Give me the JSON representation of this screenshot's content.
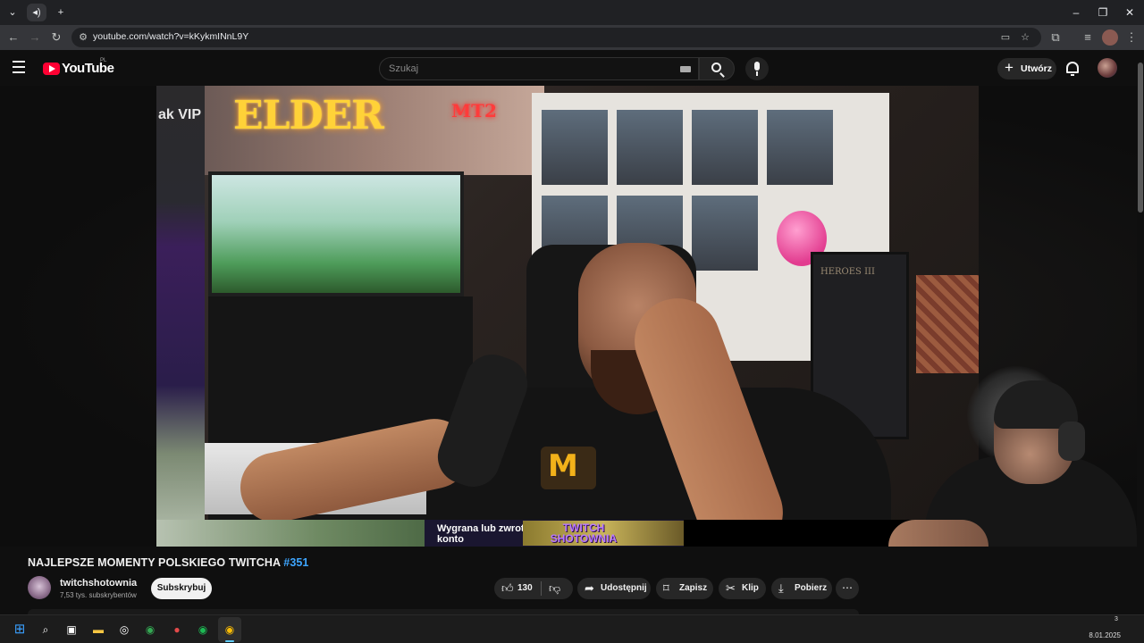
{
  "browser": {
    "tab_icon": "speaker-icon",
    "url": "youtube.com/watch?v=kKykmINnL9Y",
    "window_controls": [
      "minimize-icon",
      "maximize-icon",
      "close-icon"
    ]
  },
  "youtube": {
    "logo_text": "YouTube",
    "region": "PL",
    "search_placeholder": "Szukaj",
    "create_label": "Utwórz"
  },
  "video": {
    "left_overlay_text": "ak VIP",
    "neon_sign": "ELDER",
    "neon_sign_suffix": "MT2",
    "cabinet_text": "HEROES III",
    "ticker_text": "Wygrana lub zwrot na konto",
    "ticker_brand": "TWITCH SHOTOWNIA"
  },
  "info": {
    "title": "NAJLEPSZE MOMENTY POLSKIEGO TWITCHA ",
    "title_tag": "#351",
    "channel_name": "twitchshotownia",
    "subscribers": "7,53 tys. subskrybentów",
    "subscribe_label": "Subskrybuj",
    "like_count": "130",
    "share_label": "Udostępnij",
    "save_label": "Zapisz",
    "clip_label": "Klip",
    "download_label": "Pobierz"
  },
  "taskbar": {
    "clock_small": "3",
    "date": "8.01.2025"
  },
  "colors": {
    "yt_red": "#ff0033",
    "accent_blue": "#3ea6ff",
    "background": "#0f0f0f"
  }
}
